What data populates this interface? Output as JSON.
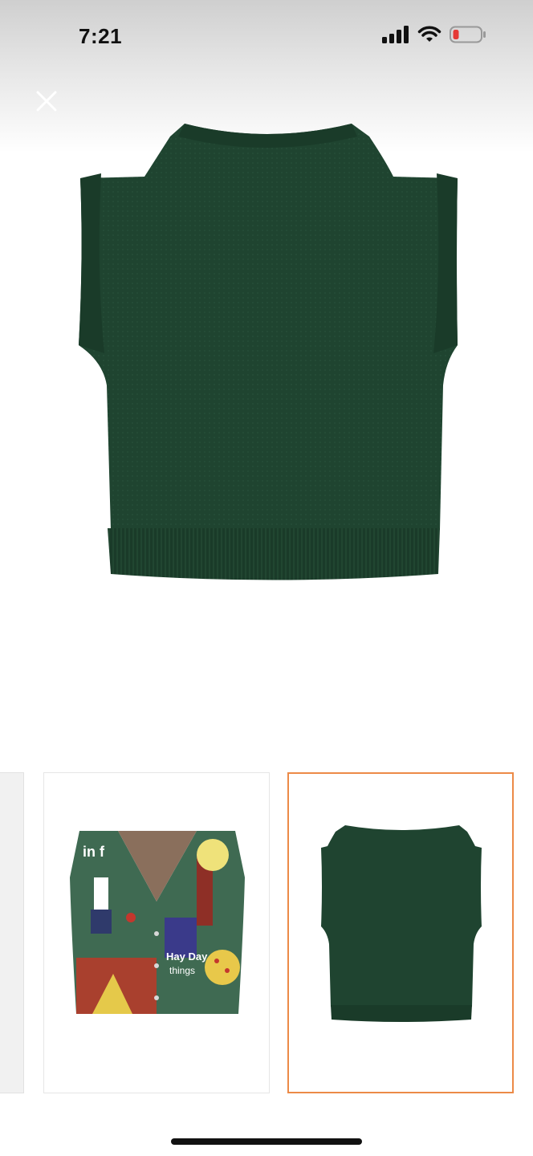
{
  "status_bar": {
    "time": "7:21",
    "icons": [
      "signal-icon",
      "wifi-icon",
      "battery-icon"
    ],
    "battery_color": "#e53935"
  },
  "viewer": {
    "close_icon": "close-icon",
    "main_image": "green-knit-vest-back",
    "thumbnails": [
      {
        "image": "previous-thumbnail",
        "selected": false
      },
      {
        "image": "patterned-vest-front",
        "printed_text": [
          "in f",
          "Hay Day",
          "things"
        ],
        "selected": false
      },
      {
        "image": "green-knit-vest-back",
        "selected": true
      }
    ],
    "selected_border_color": "#ec8a47",
    "vest_color": "#1f4430"
  }
}
